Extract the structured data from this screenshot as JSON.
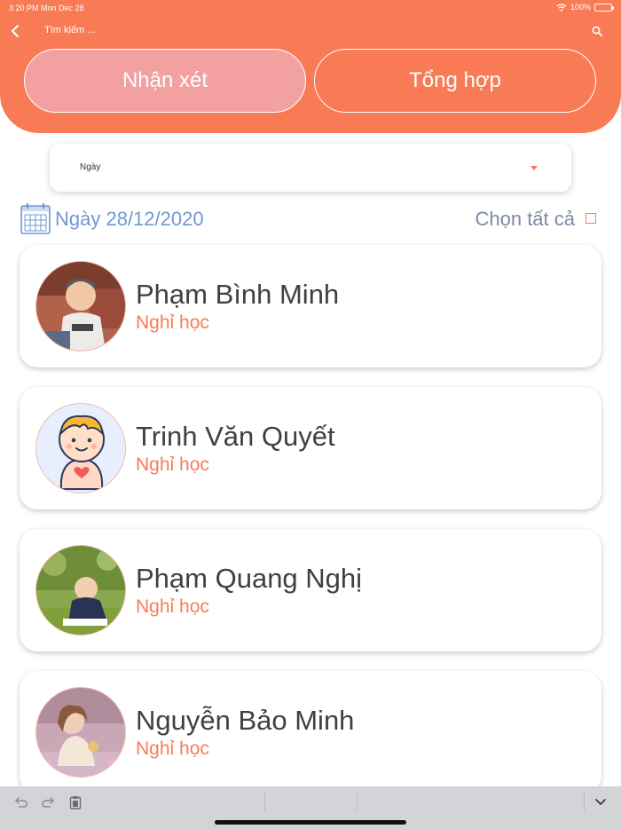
{
  "status_bar": {
    "time_date": "3:20 PM   Mon Dec 28",
    "battery": "100%",
    "battery_level": 1.0
  },
  "topbar": {
    "search_placeholder": "Tìm kiếm ..."
  },
  "tabs": [
    {
      "label": "Nhận xét",
      "active": true
    },
    {
      "label": "Tổng hợp",
      "active": false
    }
  ],
  "filter": {
    "selected": "Ngày"
  },
  "date_row": {
    "date": "Ngày 28/12/2020",
    "select_all": "Chọn tất cả"
  },
  "students": [
    {
      "name": "Phạm Bình Minh",
      "status": "Nghỉ học",
      "avatar": "child-photo"
    },
    {
      "name": "Trinh Văn Quyết",
      "status": "Nghỉ học",
      "avatar": "baby-cartoon-icon"
    },
    {
      "name": "Phạm Quang Nghị",
      "status": "Nghỉ học",
      "avatar": "child-photo"
    },
    {
      "name": "Nguyễn Bảo Minh",
      "status": "Nghỉ học",
      "avatar": "child-photo"
    }
  ],
  "colors": {
    "accent": "#f97b55",
    "active_tab": "#f3a0a0",
    "date": "#6f98d6",
    "name": "#404040"
  }
}
